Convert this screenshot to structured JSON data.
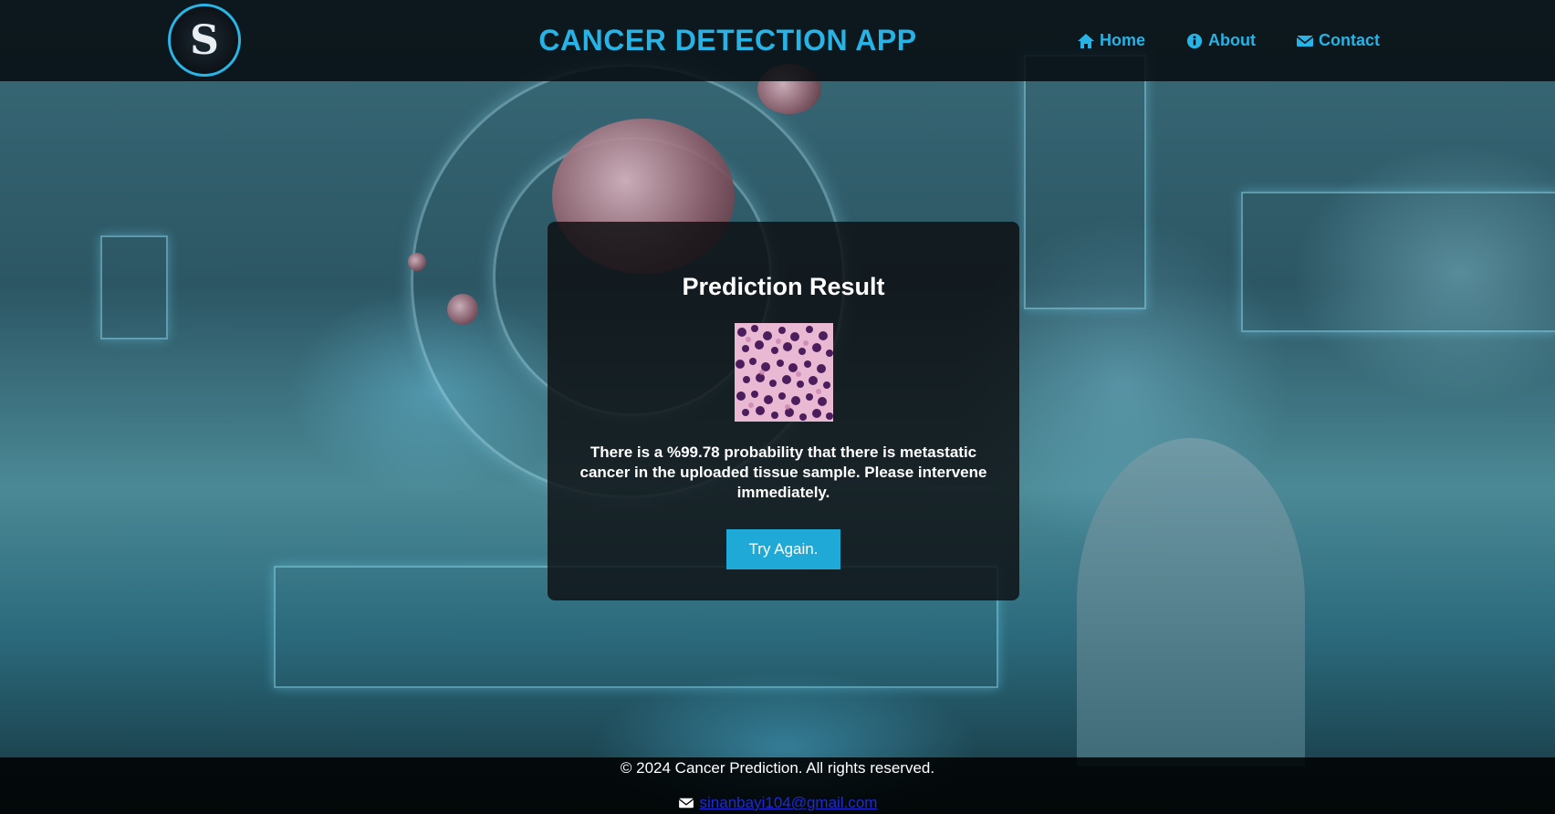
{
  "header": {
    "logo_icon": "s-monogram-logo",
    "title": "CANCER DETECTION APP",
    "nav": [
      {
        "label": "Home",
        "icon": "home-icon"
      },
      {
        "label": "About",
        "icon": "info-circle-icon"
      },
      {
        "label": "Contact",
        "icon": "envelope-icon"
      }
    ]
  },
  "result": {
    "title": "Prediction Result",
    "message": "There is a %99.78 probability that there is metastatic cancer in the uploaded tissue sample. Please intervene immediately.",
    "button_label": "Try Again."
  },
  "footer": {
    "copyright": "© 2024 Cancer Prediction. All rights reserved.",
    "email": "sinanbayi104@gmail.com",
    "email_icon": "envelope-icon"
  },
  "colors": {
    "accent": "#27b3e6",
    "button": "#1fa9d6",
    "header_bg": "#050a0e",
    "card_bg": "#0c0e10",
    "link": "#1e2bd6"
  }
}
